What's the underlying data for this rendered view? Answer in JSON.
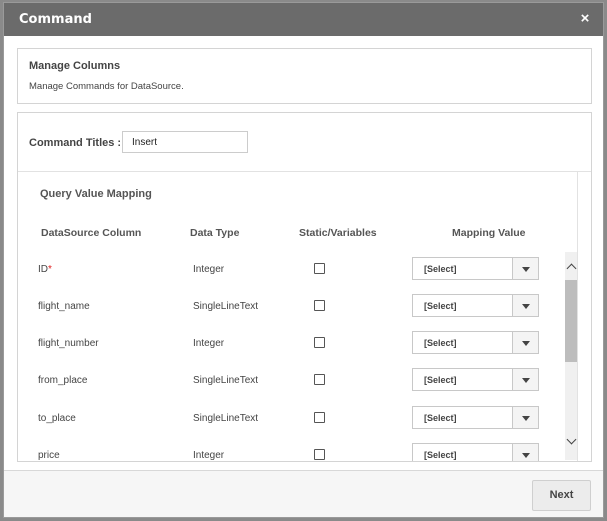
{
  "dialog": {
    "title": "Command",
    "close_glyph": "×"
  },
  "manage": {
    "title": "Manage Columns",
    "subtitle": "Manage Commands for DataSource."
  },
  "command": {
    "label": "Command Titles :",
    "value": "Insert"
  },
  "mapping": {
    "title": "Query Value Mapping",
    "headers": {
      "column": "DataSource Column",
      "type": "Data Type",
      "static": "Static/Variables",
      "value": "Mapping Value"
    },
    "rows": [
      {
        "name": "ID",
        "required_mark": "*",
        "type": "Integer",
        "checked": false,
        "mapping": "[Select]"
      },
      {
        "name": "flight_name",
        "required_mark": "",
        "type": "SingleLineText",
        "checked": false,
        "mapping": "[Select]"
      },
      {
        "name": "flight_number",
        "required_mark": "",
        "type": "Integer",
        "checked": false,
        "mapping": "[Select]"
      },
      {
        "name": "from_place",
        "required_mark": "",
        "type": "SingleLineText",
        "checked": false,
        "mapping": "[Select]"
      },
      {
        "name": "to_place",
        "required_mark": "",
        "type": "SingleLineText",
        "checked": false,
        "mapping": "[Select]"
      },
      {
        "name": "price",
        "required_mark": "",
        "type": "Integer",
        "checked": false,
        "mapping": "[Select]"
      }
    ]
  },
  "footer": {
    "next_label": "Next"
  }
}
